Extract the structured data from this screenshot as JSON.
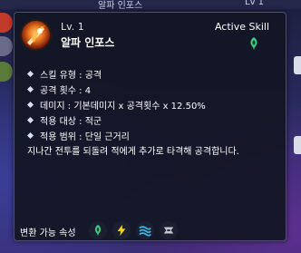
{
  "background": {
    "top_left_text": "알파 인포스",
    "top_right_text": "Lv 1"
  },
  "skill": {
    "level": "Lv.  1",
    "name": "알파 인포스",
    "type": "Active Skill",
    "icon": "fire-slash-icon",
    "attribute_icon": "wind-icon"
  },
  "stats": [
    {
      "text": "스킬 유형 : 공격"
    },
    {
      "text": "공격 횟수 : 4"
    },
    {
      "text": "데미지 : 기본데미지 x 공격횟수 x  12.50%"
    },
    {
      "text": "적용 대상 : 적군"
    },
    {
      "text": "적용 범위 :  단일 근거리"
    }
  ],
  "description": "지나간 전투를 되돌려 적에게 추가로 타격해 공격합니다.",
  "attributes": {
    "label": "변환 가능 속성",
    "icons": [
      "wind-icon",
      "lightning-icon",
      "water-icon",
      "dark-icon"
    ]
  },
  "colors": {
    "panel": "#12162a",
    "wind": "#3fcf8a",
    "lightning": "#f2d21b",
    "water": "#36b6e8",
    "dark": "#c8c8d4"
  }
}
